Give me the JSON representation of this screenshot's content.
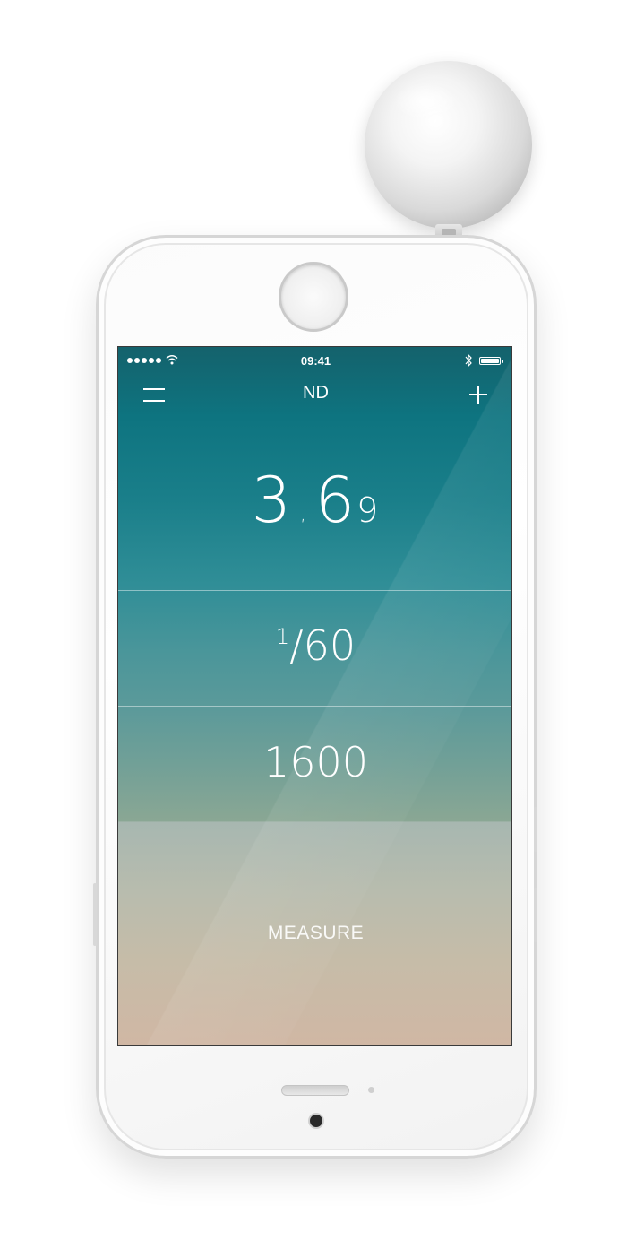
{
  "status_bar": {
    "time": "09:41",
    "signal_bars": 5,
    "wifi_icon": "wifi-icon",
    "bluetooth_icon": "bluetooth-icon",
    "battery_level": 1.0
  },
  "nav": {
    "title": "ND",
    "left_icon": "menu-icon",
    "right_icon": "plus-icon"
  },
  "readings": {
    "aperture_main": "3",
    "aperture_sep": ",",
    "aperture_decimal": "6",
    "aperture_fraction": "9",
    "shutter_numerator": "1",
    "shutter_rest": "/60",
    "iso": "1600"
  },
  "action": {
    "measure_label": "MEASURE"
  },
  "colors": {
    "screen_top": "#14626c",
    "screen_mid": "#5c9a9a",
    "screen_bottom": "#d0b7a4",
    "text": "#ffffff"
  }
}
